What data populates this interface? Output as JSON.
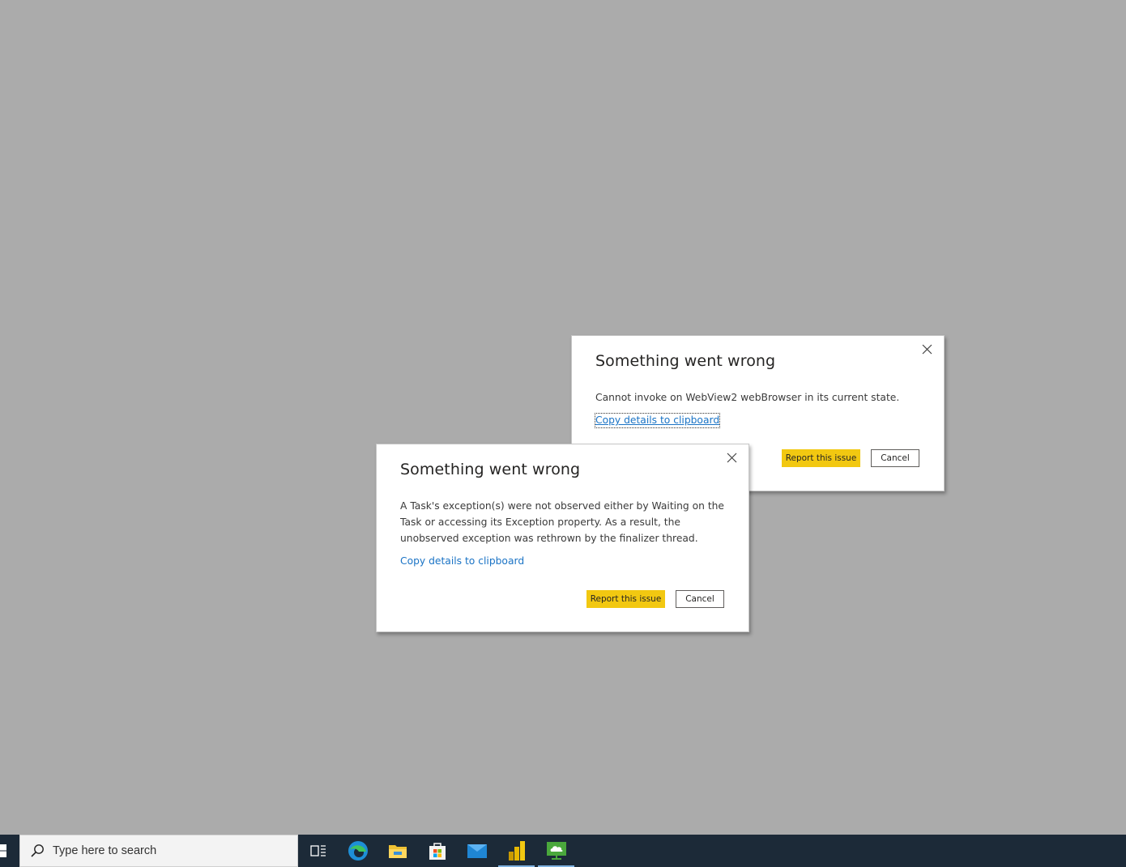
{
  "dialogs": [
    {
      "title": "Something went wrong",
      "message": "Cannot invoke on WebView2 webBrowser in its current state.",
      "copy_link": "Copy details to clipboard",
      "report_button": "Report this issue",
      "cancel_button": "Cancel"
    },
    {
      "title": "Something went wrong",
      "message": "A Task's exception(s) were not observed either by Waiting on the Task or accessing its Exception property. As a result, the unobserved exception was rethrown by the finalizer thread.",
      "copy_link": "Copy details to clipboard",
      "report_button": "Report this issue",
      "cancel_button": "Cancel"
    }
  ],
  "taskbar": {
    "search_placeholder": "Type here to search",
    "icons": [
      "windows-start-icon",
      "search-icon",
      "task-view-icon",
      "edge-icon",
      "file-explorer-icon",
      "microsoft-store-icon",
      "mail-icon",
      "power-bi-icon",
      "cloud-app-icon"
    ]
  },
  "colors": {
    "desktop_background": "#ababab",
    "accent_yellow": "#f2c811",
    "link_blue": "#1a73c5",
    "taskbar": "#1c2a38"
  }
}
